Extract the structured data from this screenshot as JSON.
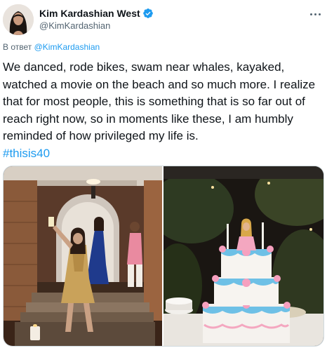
{
  "author": {
    "display_name": "Kim Kardashian West",
    "handle": "@KimKardashian",
    "verified": true,
    "avatar_icon": "avatar-photo"
  },
  "reply": {
    "prefix": "В ответ",
    "mention": "@KimKardashian"
  },
  "tweet": {
    "text": "We danced, rode bikes, swam near whales, kayaked, watched a movie on the beach and so much more. I realize that for most people, this is something that is so far out of reach right now, so in moments like these, I am humbly reminded of how privileged my life is.",
    "hashtag": "#thisis40"
  },
  "media": {
    "photos": [
      {
        "icon": "party-photo"
      },
      {
        "icon": "cake-photo"
      }
    ]
  },
  "colors": {
    "accent": "#1d9bf0",
    "text": "#0f1419",
    "secondary": "#536471",
    "border": "#cfd9de"
  }
}
